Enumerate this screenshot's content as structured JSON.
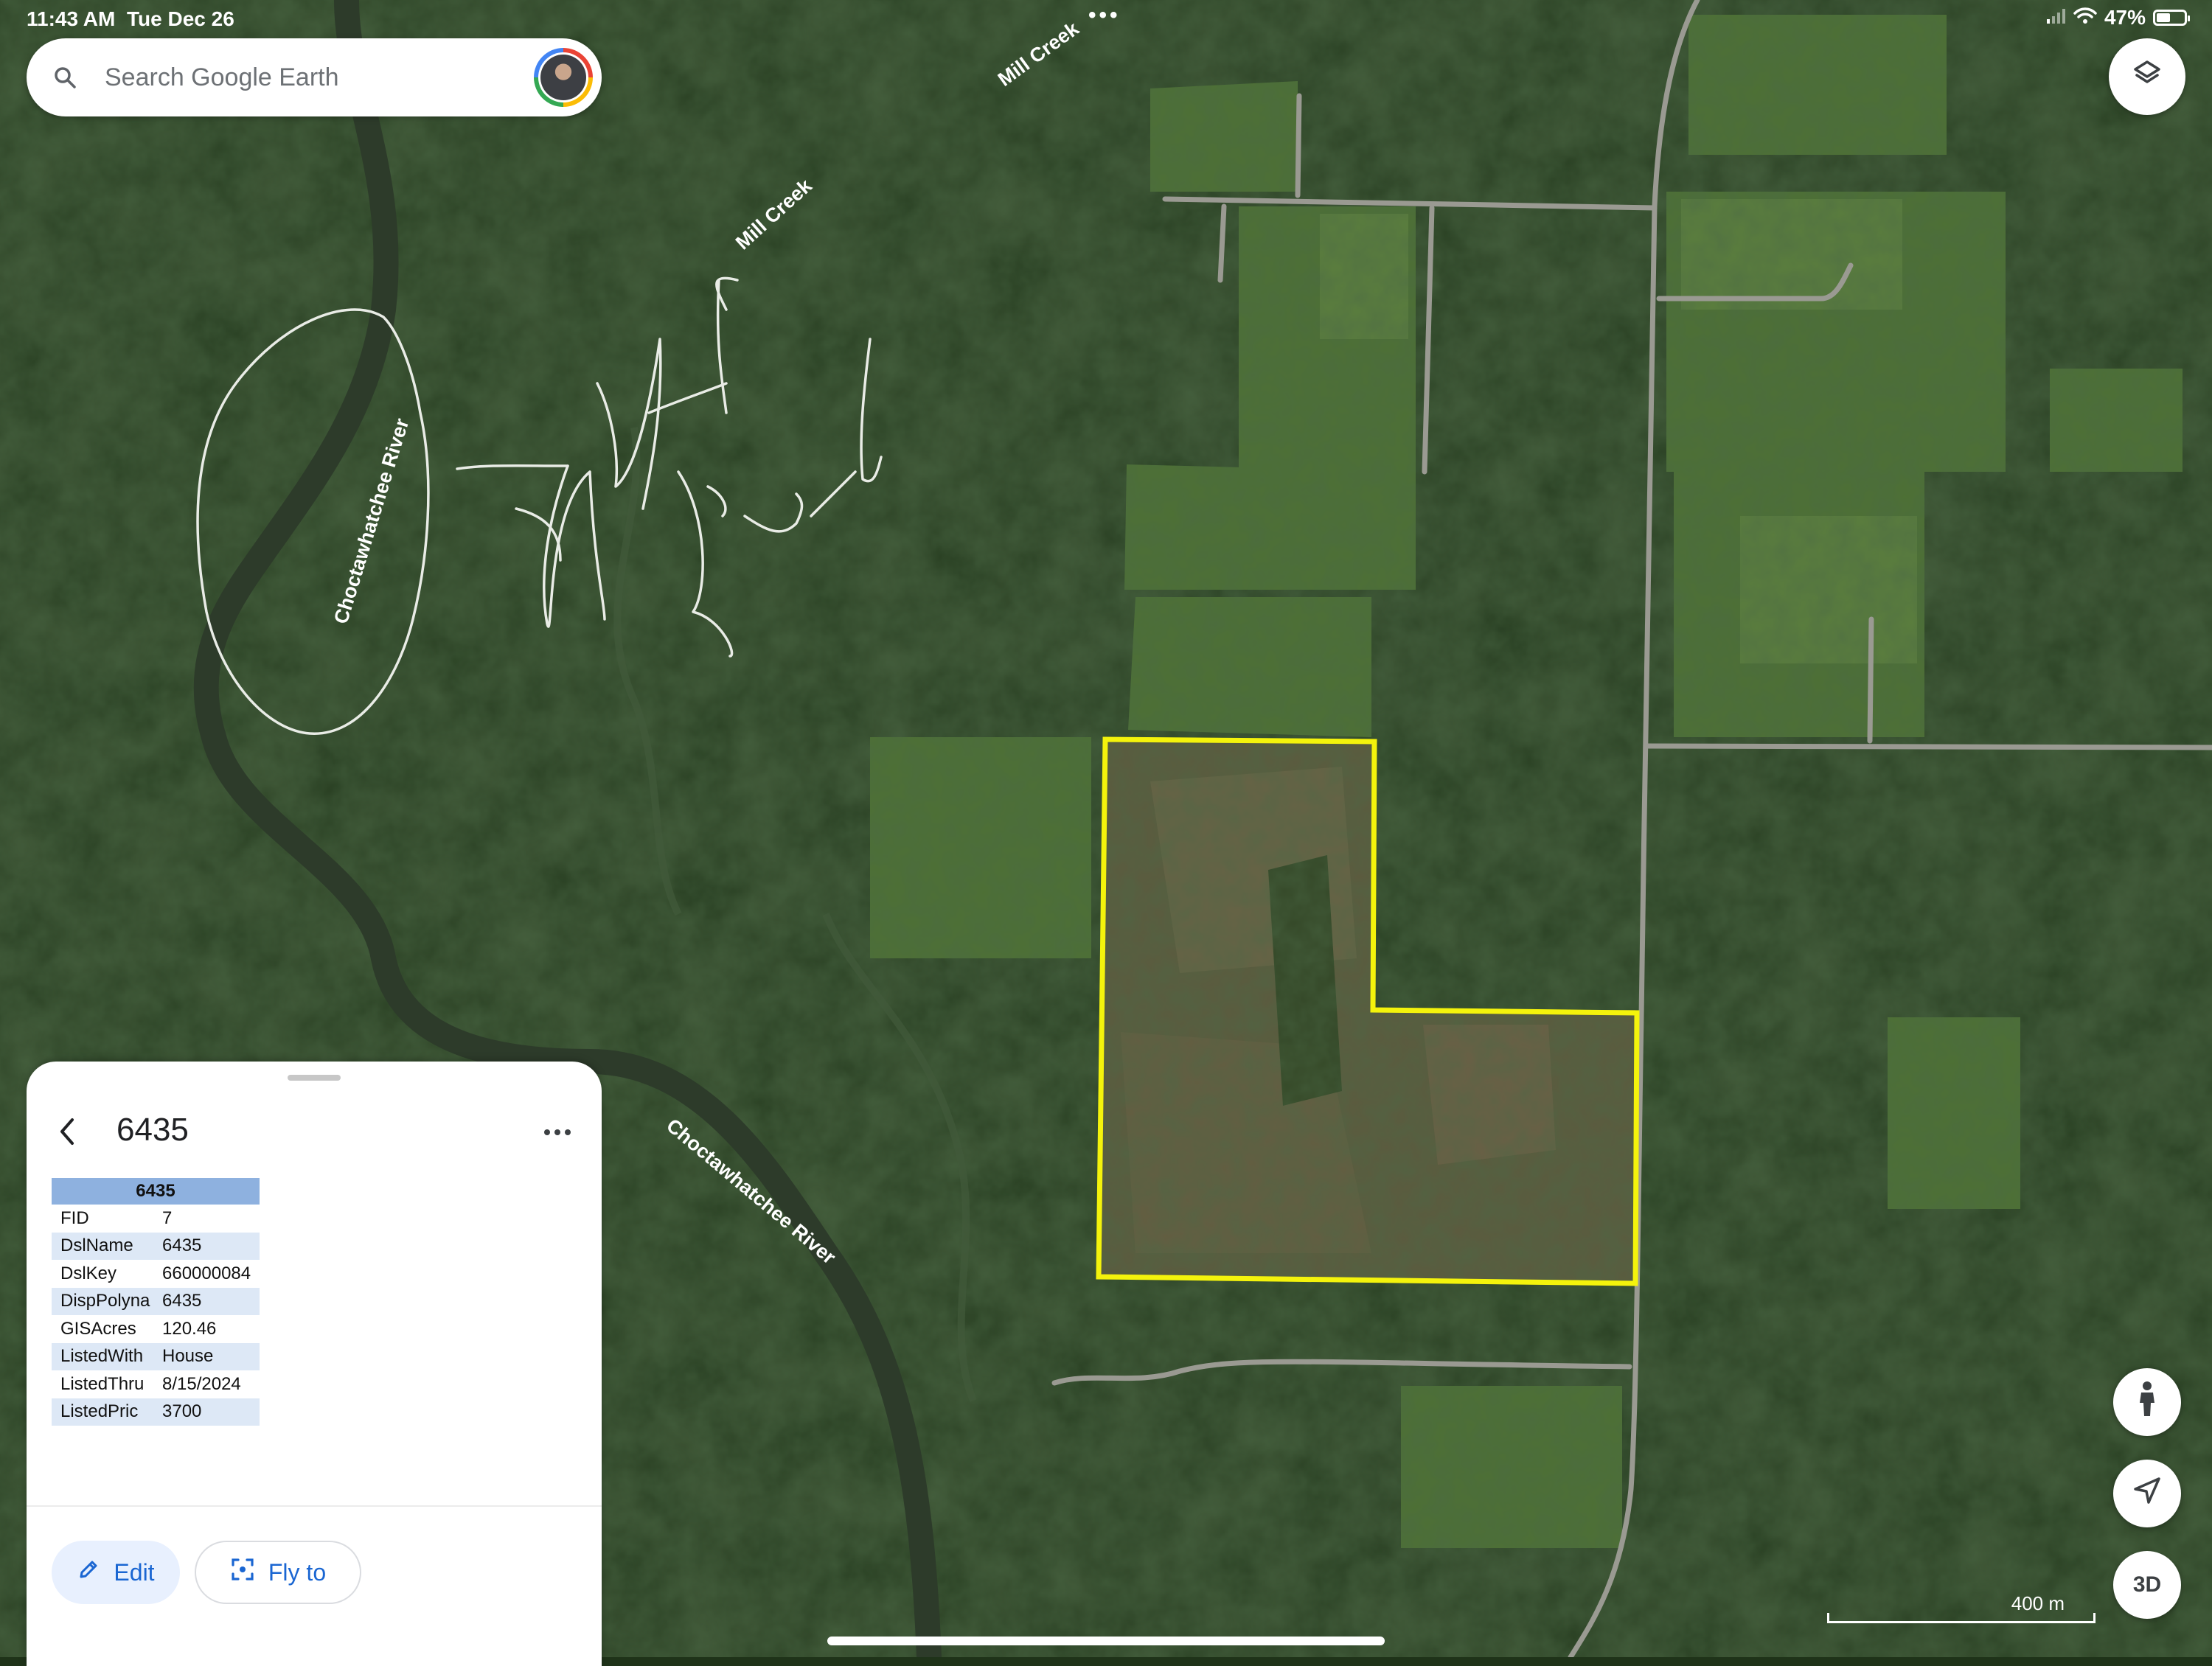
{
  "status_bar": {
    "time": "11:43 AM",
    "date": "Tue Dec 26",
    "battery": "47%",
    "battery_level": 0.47,
    "more": "•••"
  },
  "search": {
    "placeholder": "Search Google Earth"
  },
  "map": {
    "labels": {
      "mill_creek_1": "Mill Creek",
      "mill_creek_2": "Mill Creek",
      "river_1": "Choctawhatchee River",
      "river_2": "Choctawhatchee River"
    },
    "parcel_outline_color": "#f4f30c",
    "scale_label": "400 m"
  },
  "controls": {
    "three_d_label": "3D"
  },
  "panel": {
    "title": "6435",
    "table": {
      "header": "6435",
      "rows": [
        {
          "key": "FID",
          "value": "7"
        },
        {
          "key": "DslName",
          "value": "6435"
        },
        {
          "key": "DslKey",
          "value": "660000084"
        },
        {
          "key": "DispPolyna",
          "value": "6435"
        },
        {
          "key": "GISAcres",
          "value": "120.46"
        },
        {
          "key": "ListedWith",
          "value": "House"
        },
        {
          "key": "ListedThru",
          "value": "8/15/2024"
        },
        {
          "key": "ListedPric",
          "value": "3700"
        }
      ]
    },
    "edit_label": "Edit",
    "flyto_label": "Fly to"
  },
  "icons": {
    "search": "search-icon",
    "layers": "layers-icon",
    "pegman": "pegman-icon",
    "locate": "location-arrow-icon",
    "back": "chevron-left-icon",
    "more": "more-horizontal-icon",
    "edit": "pencil-icon",
    "flyto": "focus-frame-icon",
    "wifi": "wifi-icon",
    "signal": "signal-icon",
    "battery": "battery-icon"
  }
}
